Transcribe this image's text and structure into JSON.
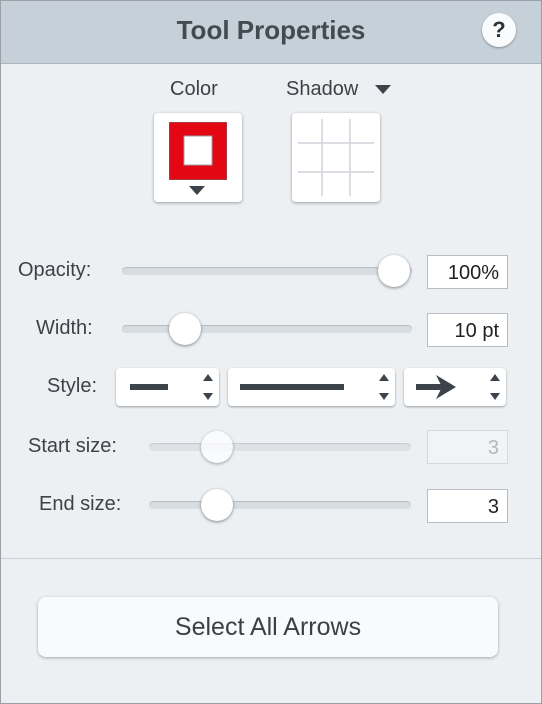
{
  "header": {
    "title": "Tool Properties",
    "help_label": "?"
  },
  "colorSection": {
    "color_label": "Color",
    "shadow_label": "Shadow",
    "border_color": "#e30613"
  },
  "opacity": {
    "label": "Opacity:",
    "value": "100%",
    "level": 1.0
  },
  "width": {
    "label": "Width:",
    "value": "10 pt",
    "level": 0.2
  },
  "style": {
    "label": "Style:",
    "line_style": "solid-thick",
    "line_type": "solid",
    "arrow_end": "arrow-right"
  },
  "startSize": {
    "label": "Start size:",
    "value": "3",
    "enabled": false,
    "level": 0.25
  },
  "endSize": {
    "label": "End size:",
    "value": "3",
    "enabled": true,
    "level": 0.25
  },
  "action": {
    "select_all_label": "Select All Arrows"
  }
}
